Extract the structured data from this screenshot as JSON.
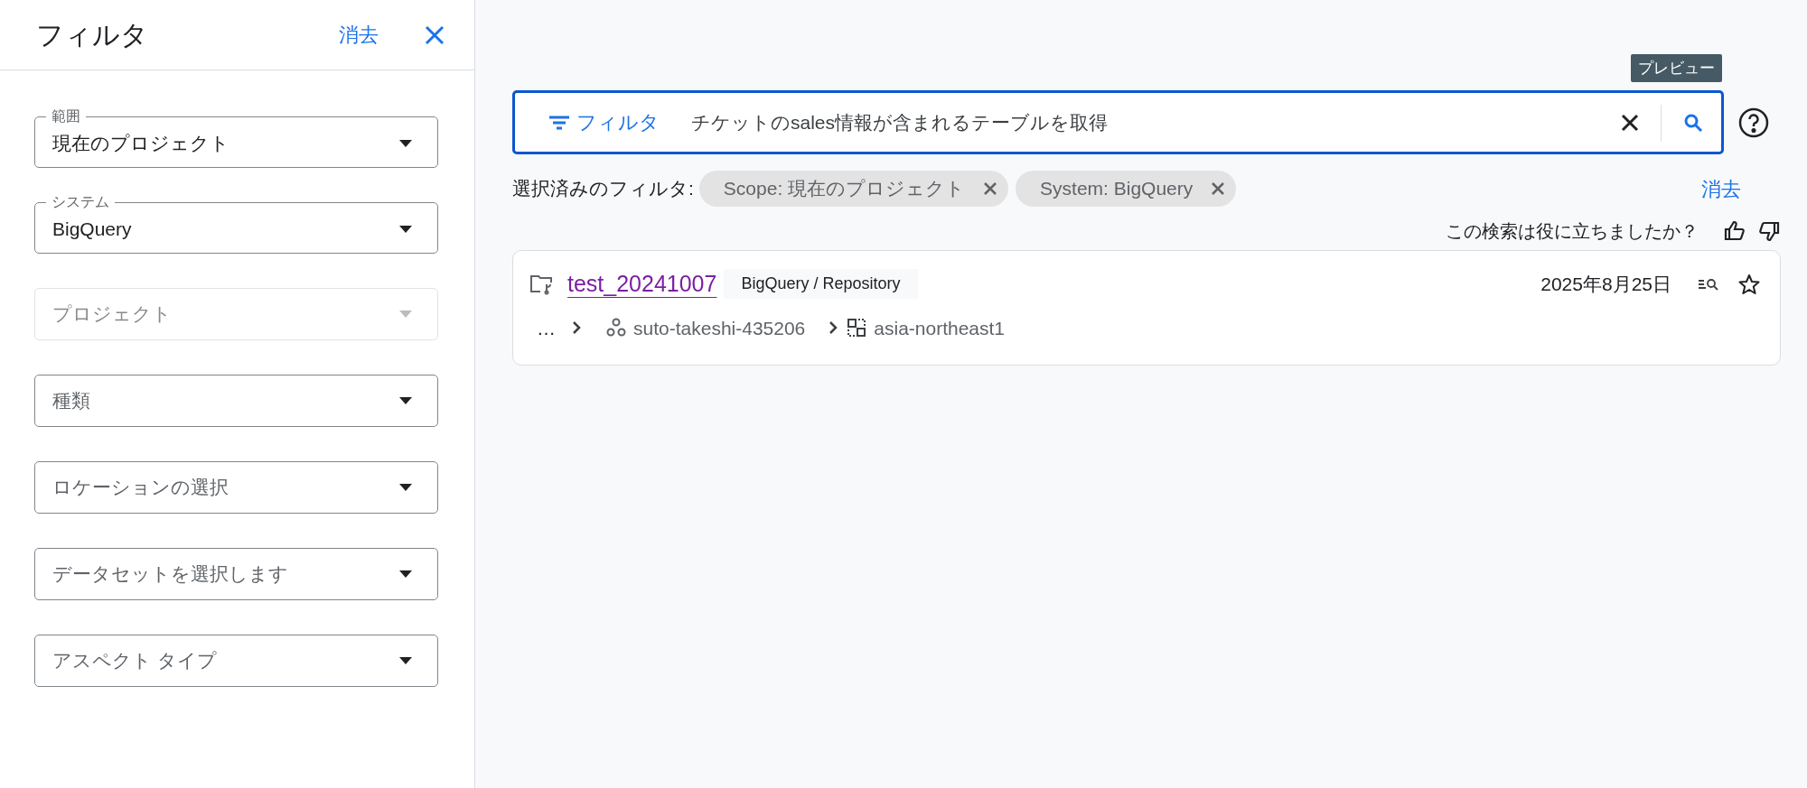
{
  "sidebar": {
    "title": "フィルタ",
    "clear_link": "消去",
    "dropdowns": [
      {
        "label": "範囲",
        "value": "現在のプロジェクト",
        "disabled": false
      },
      {
        "label": "システム",
        "value": "BigQuery",
        "disabled": false
      },
      {
        "placeholder": "プロジェクト",
        "disabled": true
      },
      {
        "placeholder": "種類",
        "disabled": false
      },
      {
        "placeholder": "ロケーションの選択",
        "disabled": false
      },
      {
        "placeholder": "データセットを選択します",
        "disabled": false
      },
      {
        "placeholder": "アスペクト タイプ",
        "disabled": false
      }
    ]
  },
  "main": {
    "tooltip": "プレビュー",
    "search": {
      "filter_button": "フィルタ",
      "value": "チケットのsales情報が含まれるテーブルを取得"
    },
    "selected_filters": {
      "label": "選択済みのフィルタ:",
      "chips": [
        "Scope: 現在のプロジェクト",
        "System: BigQuery"
      ],
      "clear_link": "消去"
    },
    "feedback": "この検索は役に立ちましたか？",
    "results": [
      {
        "name": "test_20241007",
        "tag": "BigQuery / Repository",
        "date": "2025年8月25日",
        "path": [
          "…",
          "suto-takeshi-435206",
          "asia-northeast1"
        ]
      }
    ]
  }
}
